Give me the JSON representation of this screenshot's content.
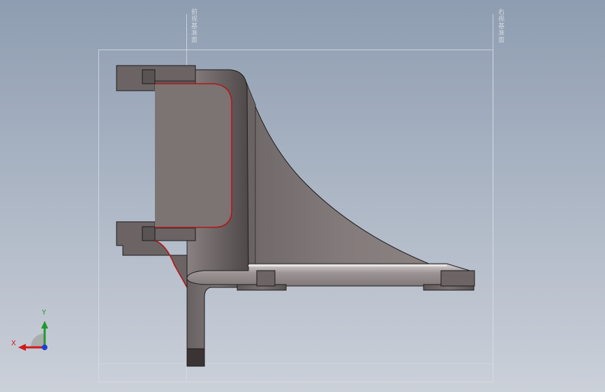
{
  "viewport": {
    "background_top": "#8e9db1",
    "background_bottom": "#c9ced8",
    "part_color": "#7d7474",
    "section_edge_color": "#b01818",
    "plane_outline_color": "#d7dde6"
  },
  "plane_labels": {
    "left": "前视基准面",
    "right": "右视基准面"
  },
  "triad": {
    "x_label": "X",
    "y_label": "Y",
    "x_color": "#d11a1a",
    "y_color": "#1f9a2a",
    "z_color": "#1d3fd6"
  }
}
